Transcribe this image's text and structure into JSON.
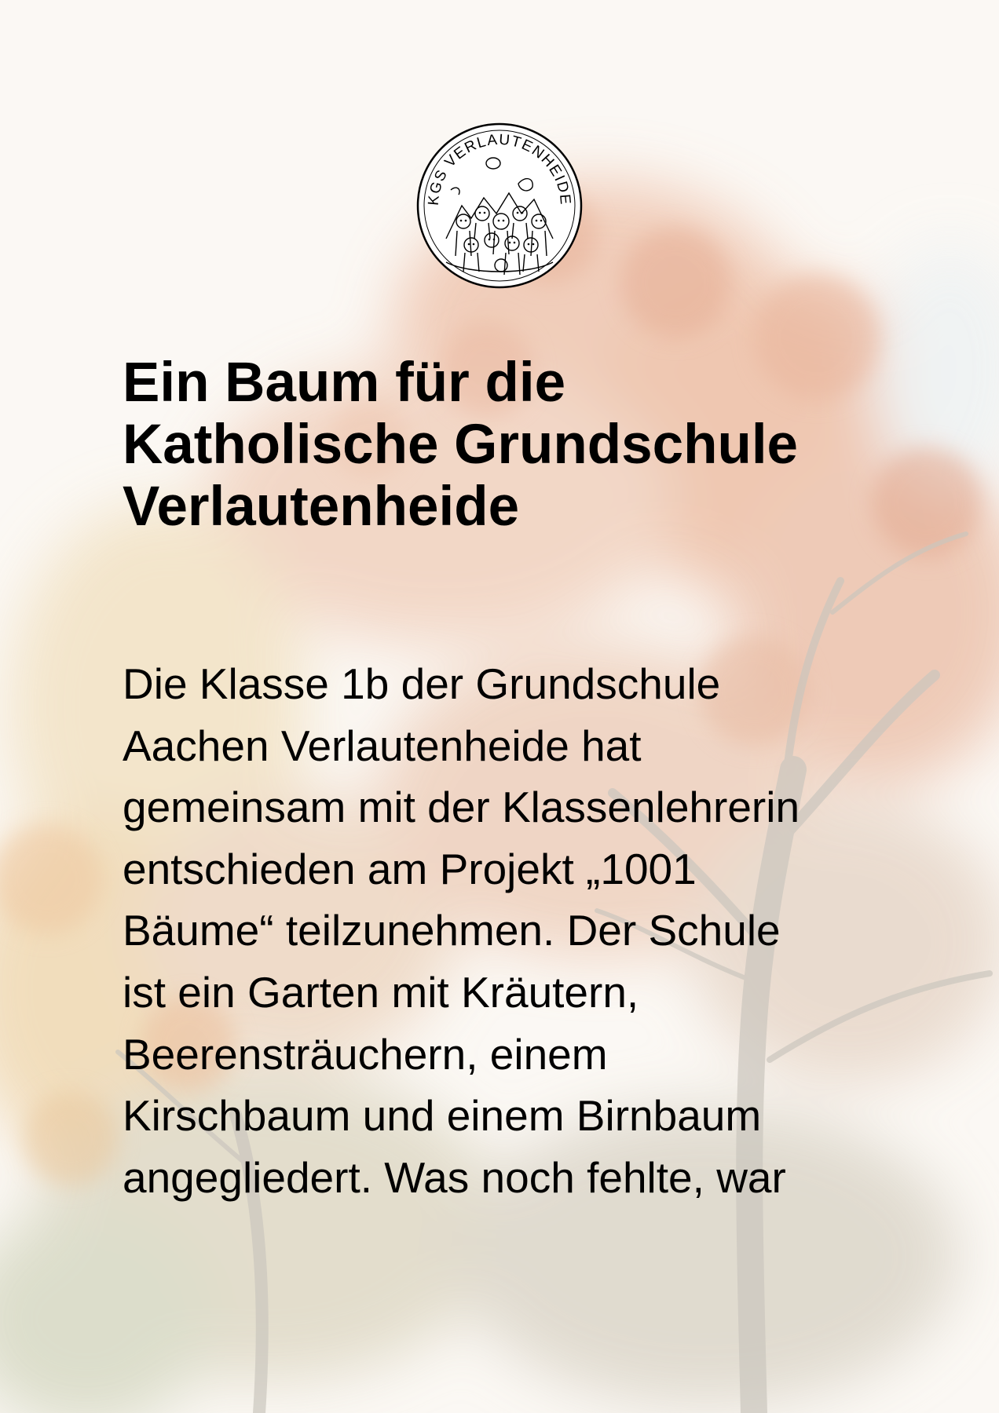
{
  "logo": {
    "text": "KGS VERLAUTENHEIDE"
  },
  "title_lines": [
    "Ein Baum für die",
    "Katholische Grundschule",
    "Verlautenheide"
  ],
  "body_lines": [
    "Die Klasse 1b der Grundschule",
    "Aachen Verlautenheide hat",
    "gemeinsam mit der Klassenlehrerin",
    "entschieden am Projekt „1001",
    "Bäume“ teilzunehmen. Der Schule",
    "ist ein Garten mit Kräutern,",
    "Beerensträuchern, einem",
    "Kirschbaum und einem Birnbaum",
    "angegliedert. Was noch fehlte, war"
  ],
  "colors": {
    "text": "#000000",
    "foliage_orange": "#e9b9a0",
    "foliage_yellow": "#efdcb6",
    "foliage_green": "#d2d4bf",
    "trunk": "#c8c4bc"
  }
}
